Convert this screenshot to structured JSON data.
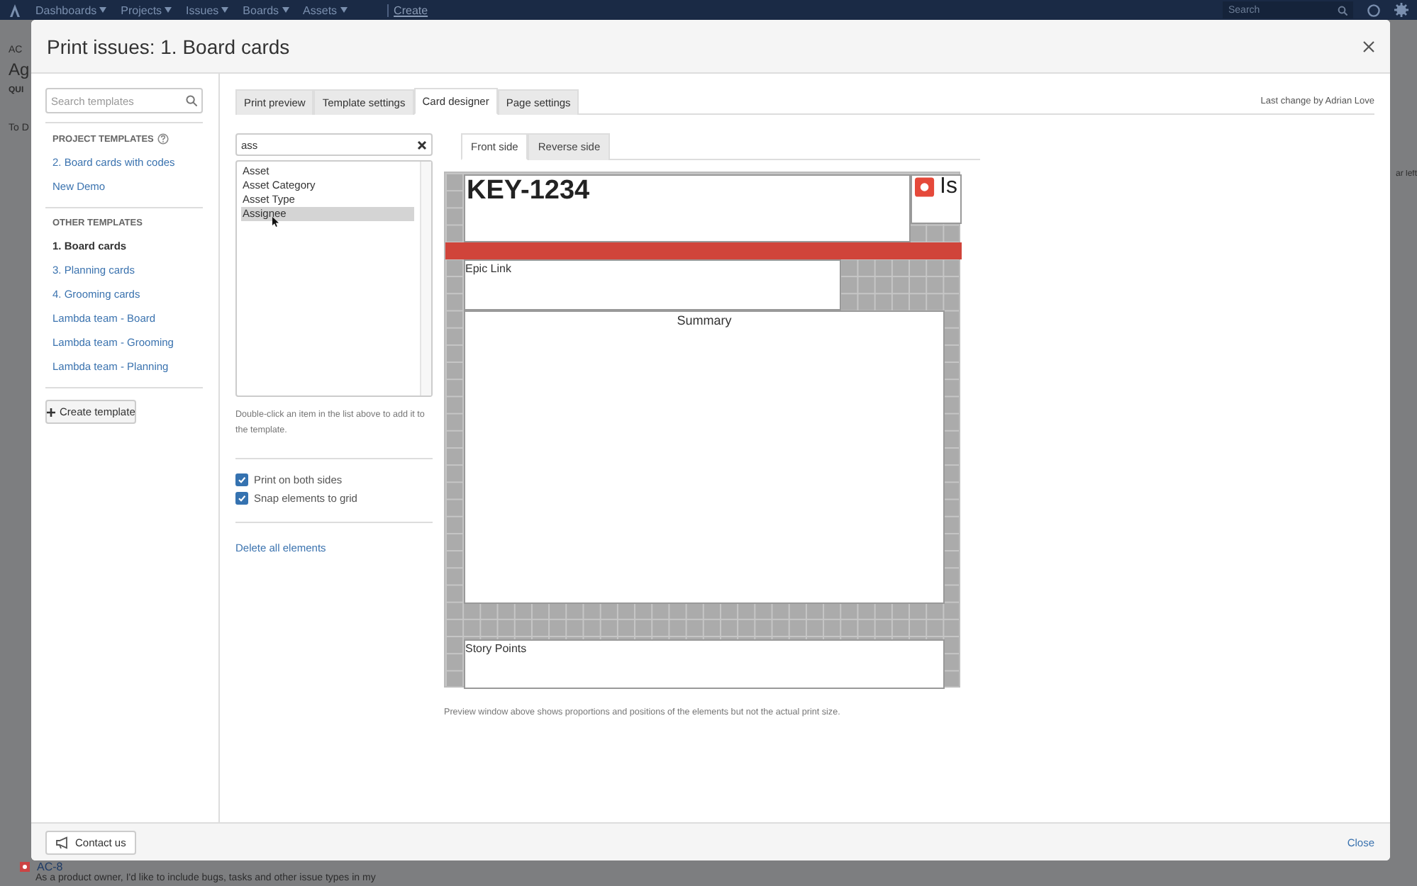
{
  "top_nav": {
    "items": [
      {
        "label": "Dashboards"
      },
      {
        "label": "Projects"
      },
      {
        "label": "Issues"
      },
      {
        "label": "Boards"
      },
      {
        "label": "Assets"
      }
    ],
    "create": "Create",
    "search": {
      "placeholder": "Search"
    }
  },
  "background": {
    "project": "AC",
    "title": "Ag",
    "quick": "QUI",
    "column": "To D",
    "side_note": "ar left",
    "issue_key": "AC-8",
    "issue_summary": "As a product owner, I'd like to include bugs, tasks and other issue types in my"
  },
  "dialog": {
    "title": "Print issues: 1. Board cards"
  },
  "sidebar": {
    "search": {
      "placeholder": "Search templates"
    },
    "sections": [
      {
        "heading": "PROJECT TEMPLATES",
        "help": true,
        "items": [
          {
            "label": "2. Board cards with codes",
            "selected": false
          },
          {
            "label": "New Demo",
            "selected": false
          }
        ]
      },
      {
        "heading": "OTHER TEMPLATES",
        "help": false,
        "items": [
          {
            "label": "1. Board cards",
            "selected": true
          },
          {
            "label": "3. Planning cards",
            "selected": false
          },
          {
            "label": "4. Grooming cards",
            "selected": false
          },
          {
            "label": "Lambda team - Board",
            "selected": false
          },
          {
            "label": "Lambda team - Grooming",
            "selected": false
          },
          {
            "label": "Lambda team - Planning",
            "selected": false
          }
        ]
      }
    ],
    "create_button": "Create template"
  },
  "tabs": [
    {
      "label": "Print preview",
      "selected": false
    },
    {
      "label": "Template settings",
      "selected": false
    },
    {
      "label": "Card designer",
      "selected": true
    },
    {
      "label": "Page settings",
      "selected": false
    }
  ],
  "last_change": "Last change by Adrian Love",
  "field_picker": {
    "search_value": "ass",
    "options": [
      {
        "label": "Asset",
        "selected": false
      },
      {
        "label": "Asset Category",
        "selected": false
      },
      {
        "label": "Asset Type",
        "selected": false
      },
      {
        "label": "Assignee",
        "selected": true
      }
    ],
    "hint": "Double-click an item in the list above to add it to the template.",
    "settings": [
      {
        "label": "Print on both sides",
        "checked": true
      },
      {
        "label": "Snap elements to grid",
        "checked": true
      }
    ],
    "delete_link": "Delete all elements"
  },
  "side_tabs": [
    {
      "label": "Front side",
      "selected": true
    },
    {
      "label": "Reverse side",
      "selected": false
    }
  ],
  "card_elements": [
    {
      "kind": "key",
      "text": "KEY-1234"
    },
    {
      "kind": "issue-type",
      "text": "Is"
    },
    {
      "kind": "color-bar"
    },
    {
      "kind": "field",
      "text": "Epic Link"
    },
    {
      "kind": "summary",
      "text": "Summary"
    },
    {
      "kind": "field",
      "text": "Story Points"
    }
  ],
  "preview_note": "Preview window above shows proportions and positions of the elements but not the actual print size.",
  "footer": {
    "contact": "Contact us",
    "close": "Close"
  }
}
